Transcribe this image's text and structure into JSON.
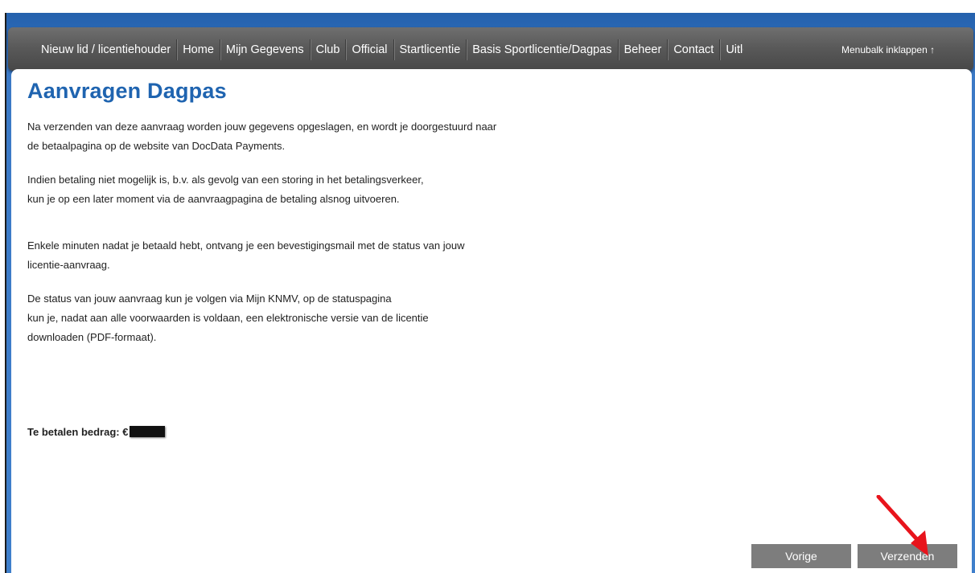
{
  "nav": {
    "items": [
      {
        "label": "Nieuw lid / licentiehouder"
      },
      {
        "label": "Home"
      },
      {
        "label": "Mijn Gegevens"
      },
      {
        "label": "Club"
      },
      {
        "label": "Official"
      },
      {
        "label": "Startlicentie"
      },
      {
        "label": "Basis Sportlicentie/Dagpas"
      },
      {
        "label": "Beheer"
      },
      {
        "label": "Contact"
      },
      {
        "label": "Uitloggen"
      }
    ],
    "collapse_label": "Menubalk inklappen ↑"
  },
  "page": {
    "title": "Aanvragen Dagpas",
    "paragraphs": {
      "p1_line1": "Na verzenden van deze aanvraag worden jouw gegevens opgeslagen, en wordt je doorgestuurd naar",
      "p1_line2": "de betaalpagina op de website van DocData Payments.",
      "p2_line1": "Indien betaling niet mogelijk is, b.v. als gevolg van een storing in het betalingsverkeer,",
      "p2_line2": "kun je op een later moment via de aanvraagpagina de betaling alsnog uitvoeren.",
      "p3_line1": "Enkele minuten nadat je betaald hebt, ontvang je een bevestigingsmail met de status van jouw",
      "p3_line2": "licentie-aanvraag.",
      "p4_line1": "De status van jouw aanvraag kun je volgen via Mijn KNMV, op de statuspagina",
      "p4_line2": "kun je, nadat aan alle voorwaarden is voldaan, een elektronische versie van de licentie",
      "p4_line3": "downloaden (PDF-formaat)."
    },
    "amount_label": "Te betalen bedrag: €"
  },
  "buttons": {
    "prev_label": "Vorige",
    "send_label": "Verzenden"
  },
  "colors": {
    "title": "#1f64b0",
    "header_blue": "#2a68b8",
    "navbar": "#5a5a5a",
    "button": "#7d7d7d",
    "annotation_arrow": "#e8141c"
  }
}
